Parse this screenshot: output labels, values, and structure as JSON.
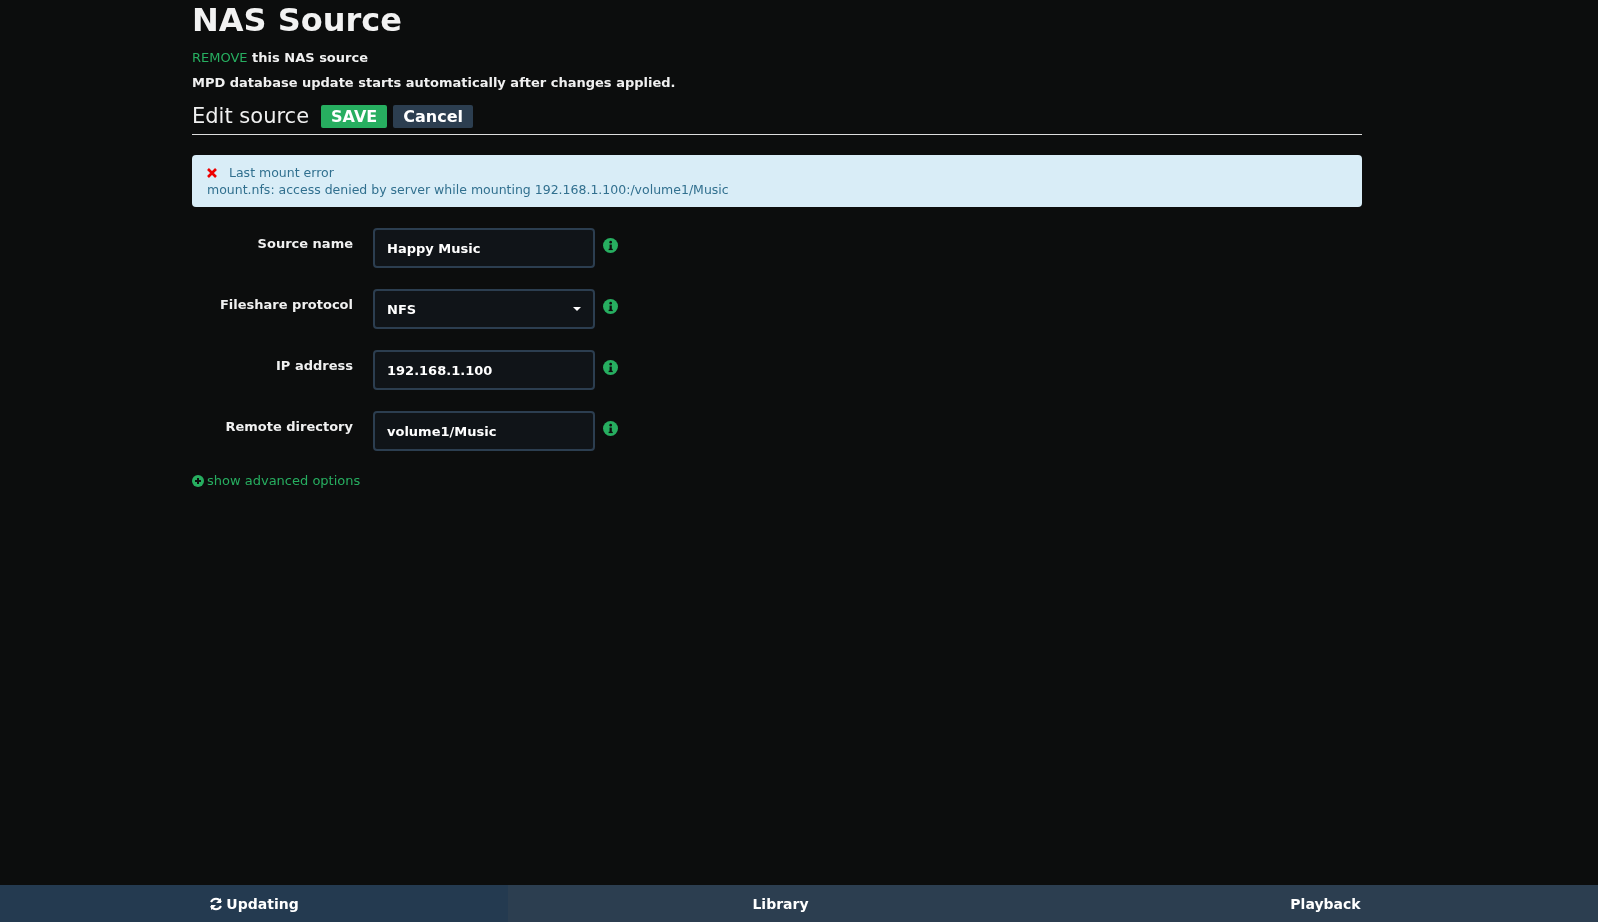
{
  "page_title": "NAS Source",
  "remove_line": {
    "link": "REMOVE",
    "text": "this NAS source"
  },
  "note": "MPD database update starts automatically after changes applied.",
  "edit_header": {
    "title": "Edit source",
    "buttons": [
      {
        "label": "SAVE",
        "kind": "primary"
      },
      {
        "label": "Cancel",
        "kind": "secondary"
      }
    ]
  },
  "alert": {
    "title": "Last mount error",
    "message": "mount.nfs: access denied by server while mounting 192.168.1.100:/volume1/Music"
  },
  "fields": [
    {
      "label": "Source name",
      "kind": "text",
      "value": "Happy Music"
    },
    {
      "label": "Fileshare protocol",
      "kind": "select",
      "value": "NFS"
    },
    {
      "label": "IP address",
      "kind": "text",
      "value": "192.168.1.100"
    },
    {
      "label": "Remote directory",
      "kind": "text",
      "value": "volume1/Music"
    }
  ],
  "advanced_link": "show advanced options",
  "footer_tabs": [
    {
      "label": "Updating",
      "kind": "status"
    },
    {
      "label": "Library",
      "kind": "plain"
    },
    {
      "label": "Playback",
      "kind": "plain"
    }
  ]
}
